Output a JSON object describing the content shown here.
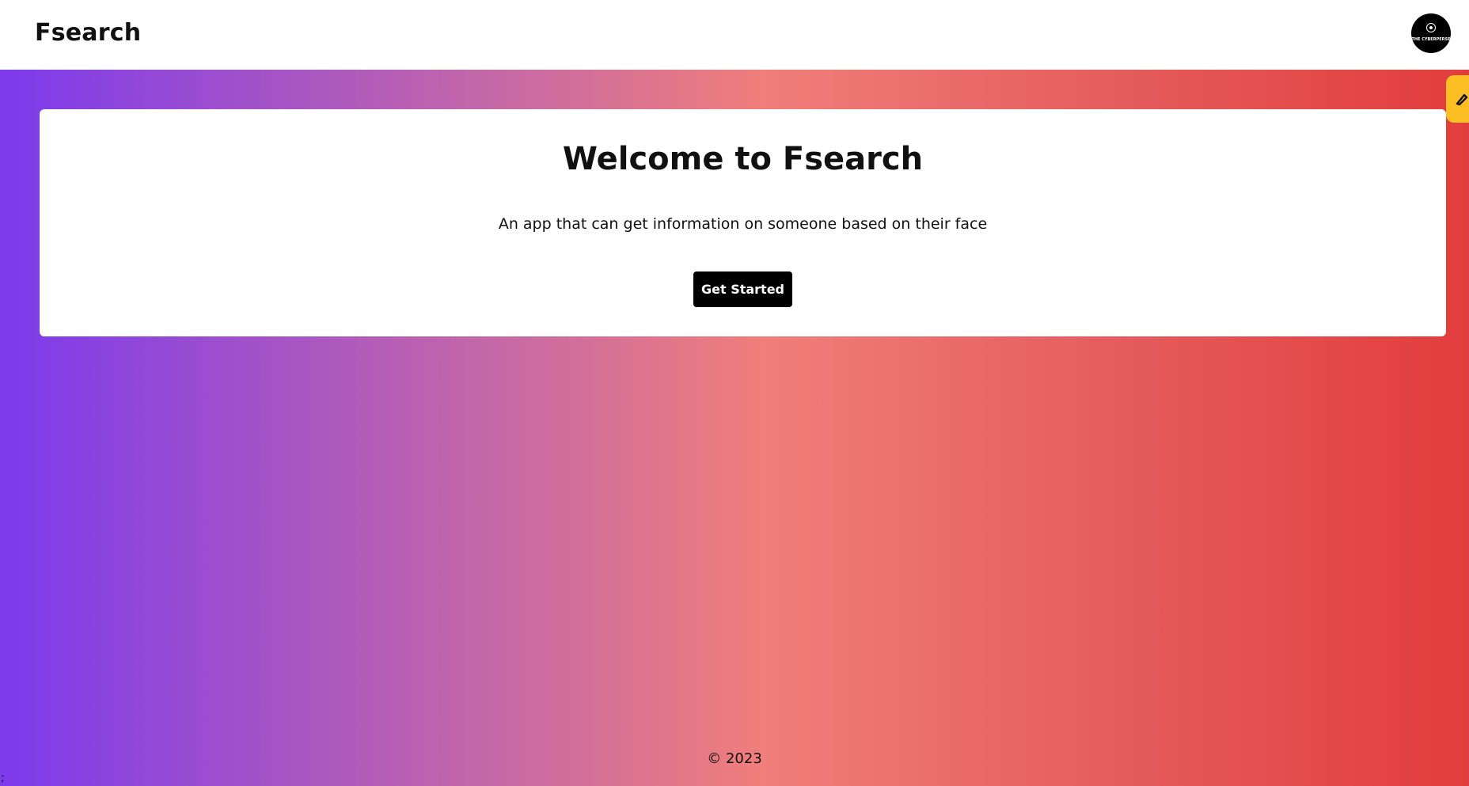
{
  "header": {
    "brand": "Fsearch",
    "avatar_text": "THE CYBERPERSE"
  },
  "hero": {
    "title": "Welcome to Fsearch",
    "subtitle": "An app that can get information on someone based on their face",
    "cta_label": "Get Started"
  },
  "footer": {
    "copyright": "© 2023"
  },
  "stray_text": ";",
  "colors": {
    "gradient_start": "#7c3aed",
    "gradient_mid": "#f07e7a",
    "gradient_end": "#e33c3c",
    "side_tab": "#fbbf24",
    "button": "#000000"
  },
  "icons": {
    "avatar": "logo-avatar",
    "side_tab": "pen-icon"
  }
}
